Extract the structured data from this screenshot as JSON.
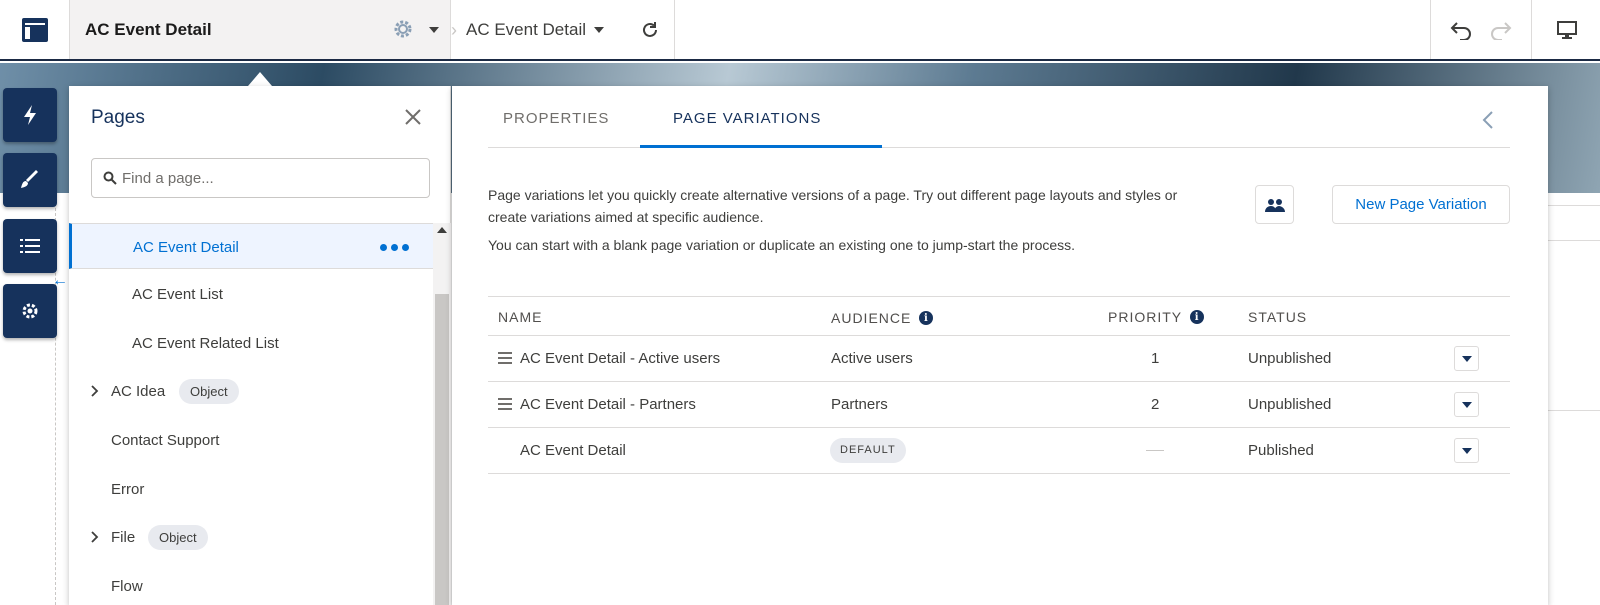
{
  "topbar": {
    "title": "AC Event Detail",
    "page_selector": "AC Event Detail"
  },
  "pages_panel": {
    "title": "Pages",
    "search_placeholder": "Find a page...",
    "items": [
      {
        "label": "AC Event Detail",
        "active": true
      },
      {
        "label": "AC Event List"
      },
      {
        "label": "AC Event Related List"
      },
      {
        "label": "AC Idea",
        "badge": "Object",
        "expandable": true
      },
      {
        "label": "Contact Support"
      },
      {
        "label": "Error"
      },
      {
        "label": "File",
        "badge": "Object",
        "expandable": true
      },
      {
        "label": "Flow"
      }
    ]
  },
  "properties_panel": {
    "tabs": [
      "PROPERTIES",
      "PAGE VARIATIONS"
    ],
    "active_tab": "PAGE VARIATIONS",
    "description": "Page variations let you quickly create alternative versions of a page. Try out different page layouts and styles or create variations aimed at specific audience.",
    "description2": "You can start with a blank page variation or duplicate an existing one to jump-start the process.",
    "new_button": "New Page Variation",
    "table": {
      "headers": [
        "NAME",
        "AUDIENCE",
        "PRIORITY",
        "STATUS"
      ],
      "rows": [
        {
          "name": "AC Event Detail - Active users",
          "audience": "Active users",
          "priority": "1",
          "status": "Unpublished"
        },
        {
          "name": "AC Event Detail - Partners",
          "audience": "Partners",
          "priority": "2",
          "status": "Unpublished"
        },
        {
          "name": "AC Event Detail",
          "audience_badge": "DEFAULT",
          "priority": "",
          "status": "Published"
        }
      ]
    }
  },
  "colors": {
    "brand_blue": "#0070d2",
    "navy": "#16325c"
  }
}
